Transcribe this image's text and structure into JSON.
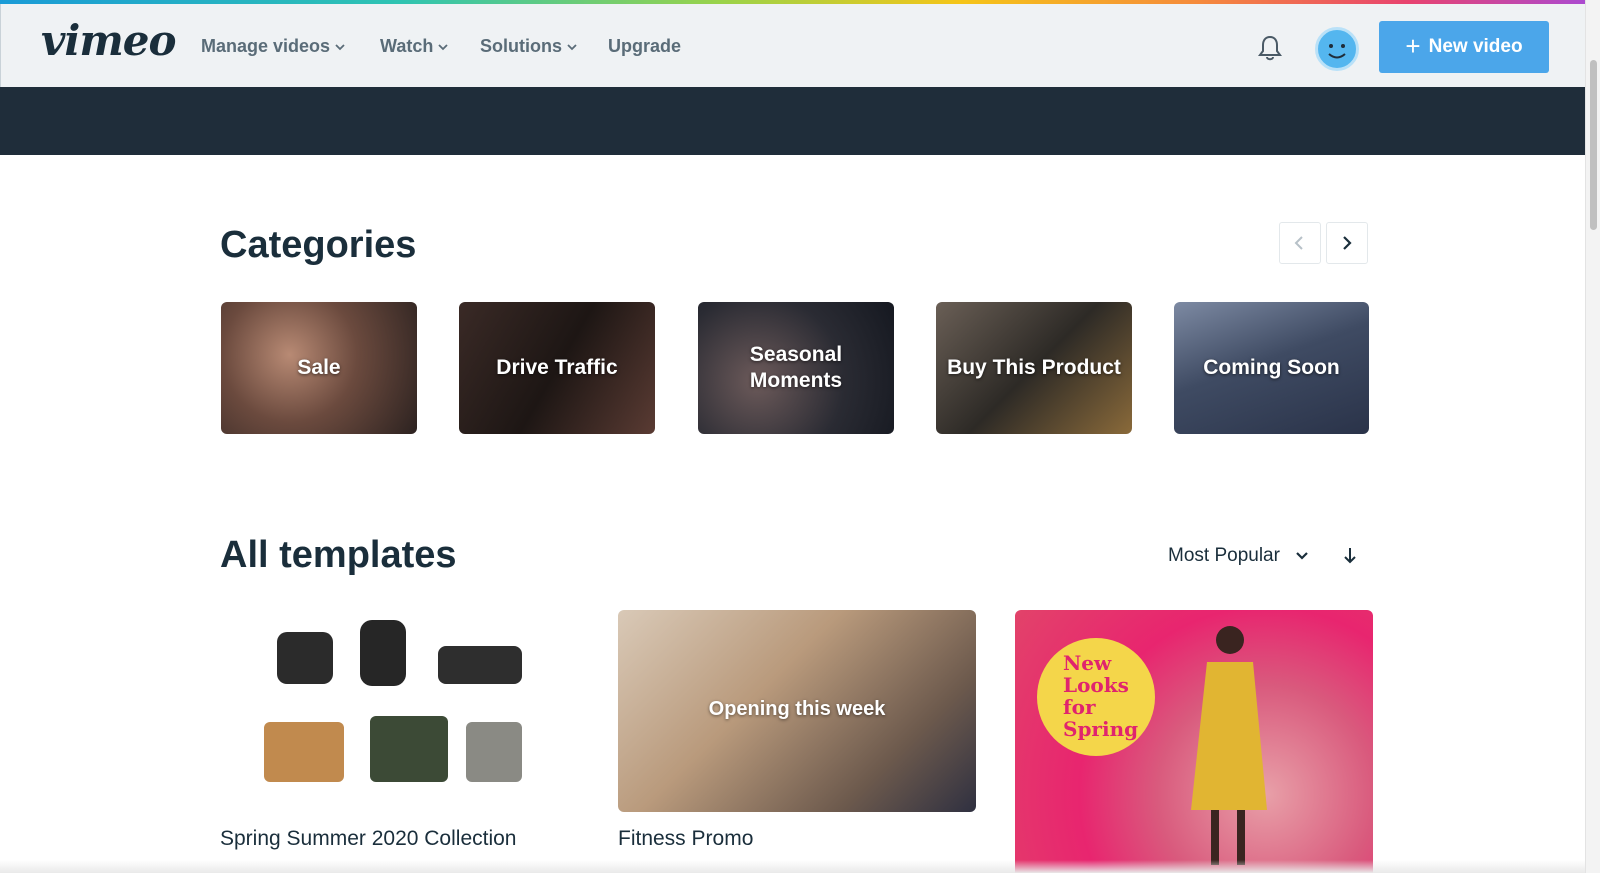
{
  "header": {
    "logo": "vimeo",
    "nav": [
      {
        "label": "Manage videos",
        "has_dropdown": true
      },
      {
        "label": "Watch",
        "has_dropdown": true
      },
      {
        "label": "Solutions",
        "has_dropdown": true
      },
      {
        "label": "Upgrade",
        "has_dropdown": false
      }
    ],
    "notifications_icon": "bell-icon",
    "avatar_icon": "smiley-avatar-icon",
    "new_video_label": "New video",
    "accent_color": "#4ba6ea"
  },
  "categories": {
    "title": "Categories",
    "prev_icon": "chevron-left-icon",
    "next_icon": "chevron-right-icon",
    "items": [
      {
        "label": "Sale"
      },
      {
        "label": "Drive Traffic"
      },
      {
        "label": "Seasonal Moments"
      },
      {
        "label": "Buy This Product"
      },
      {
        "label": "Coming Soon"
      }
    ]
  },
  "templates": {
    "title": "All templates",
    "sort_label": "Most Popular",
    "sort_icon": "chevron-down-icon",
    "sort_direction_icon": "arrow-down-icon",
    "items": [
      {
        "title": "Spring Summer 2020 Collection",
        "overlay": ""
      },
      {
        "title": "Fitness Promo",
        "overlay": "Opening this week"
      },
      {
        "title": "",
        "overlay": "New Looks for Spring"
      }
    ]
  }
}
